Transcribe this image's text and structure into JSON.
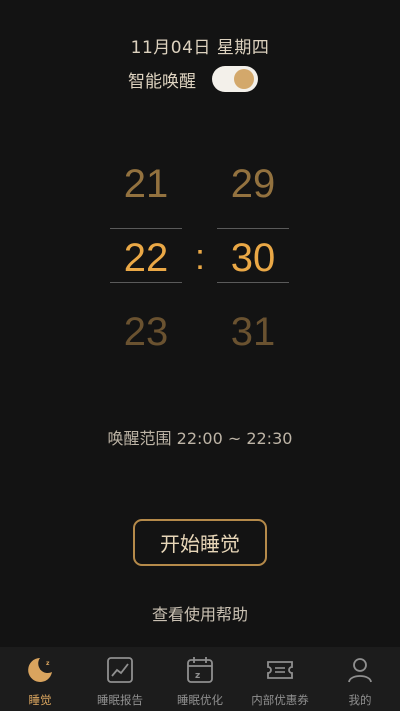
{
  "header": {
    "date_text": "11月04日 星期四",
    "smart_wake_label": "智能唤醒",
    "smart_wake_enabled": true
  },
  "picker": {
    "hours": {
      "prev": "21",
      "selected": "22",
      "next": "23"
    },
    "separator": ":",
    "minutes": {
      "prev": "29",
      "selected": "30",
      "next": "31"
    }
  },
  "wake_range_text": "唤醒范围 22:00 ~ 22:30",
  "start_button_label": "开始睡觉",
  "help_link_label": "查看使用帮助",
  "tabbar": {
    "tabs": [
      {
        "label": "睡觉",
        "icon": "moon-sleep-icon",
        "active": true
      },
      {
        "label": "睡眠报告",
        "icon": "chart-report-icon",
        "active": false
      },
      {
        "label": "睡眠优化",
        "icon": "calendar-sleep-icon",
        "active": false
      },
      {
        "label": "内部优惠券",
        "icon": "ticket-icon",
        "active": false
      },
      {
        "label": "我的",
        "icon": "person-icon",
        "active": false
      }
    ]
  },
  "colors": {
    "background": "#131313",
    "accent": "#eaa846",
    "toggle_knob": "#d3a86b",
    "button_border": "#b58a4a"
  }
}
